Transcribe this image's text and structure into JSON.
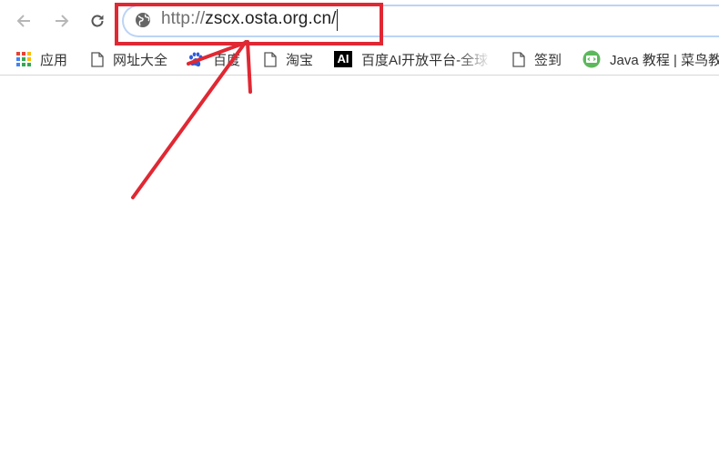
{
  "toolbar": {
    "back_icon": "arrow-left-icon",
    "forward_icon": "arrow-right-icon",
    "reload_icon": "reload-icon",
    "omnibox": {
      "site_icon": "globe-icon",
      "url_scheme": "http://",
      "url_host": "zscx.osta.org.cn/"
    }
  },
  "bookmarks": [
    {
      "label": "应用",
      "icon": "apps-grid-icon"
    },
    {
      "label": "网址大全",
      "icon": "page-icon"
    },
    {
      "label": "百度",
      "icon": "baidu-paw-icon"
    },
    {
      "label": "淘宝",
      "icon": "page-icon"
    },
    {
      "label": "百度AI开放平台-全球",
      "icon": "baidu-ai-icon",
      "icon_text": "AI"
    },
    {
      "label": "签到",
      "icon": "page-icon"
    },
    {
      "label": "Java 教程 | 菜鸟教",
      "icon": "runoob-icon"
    }
  ],
  "annotation": {
    "box_color": "#e02833",
    "arrow_color": "#e02833",
    "target": "omnibox"
  }
}
